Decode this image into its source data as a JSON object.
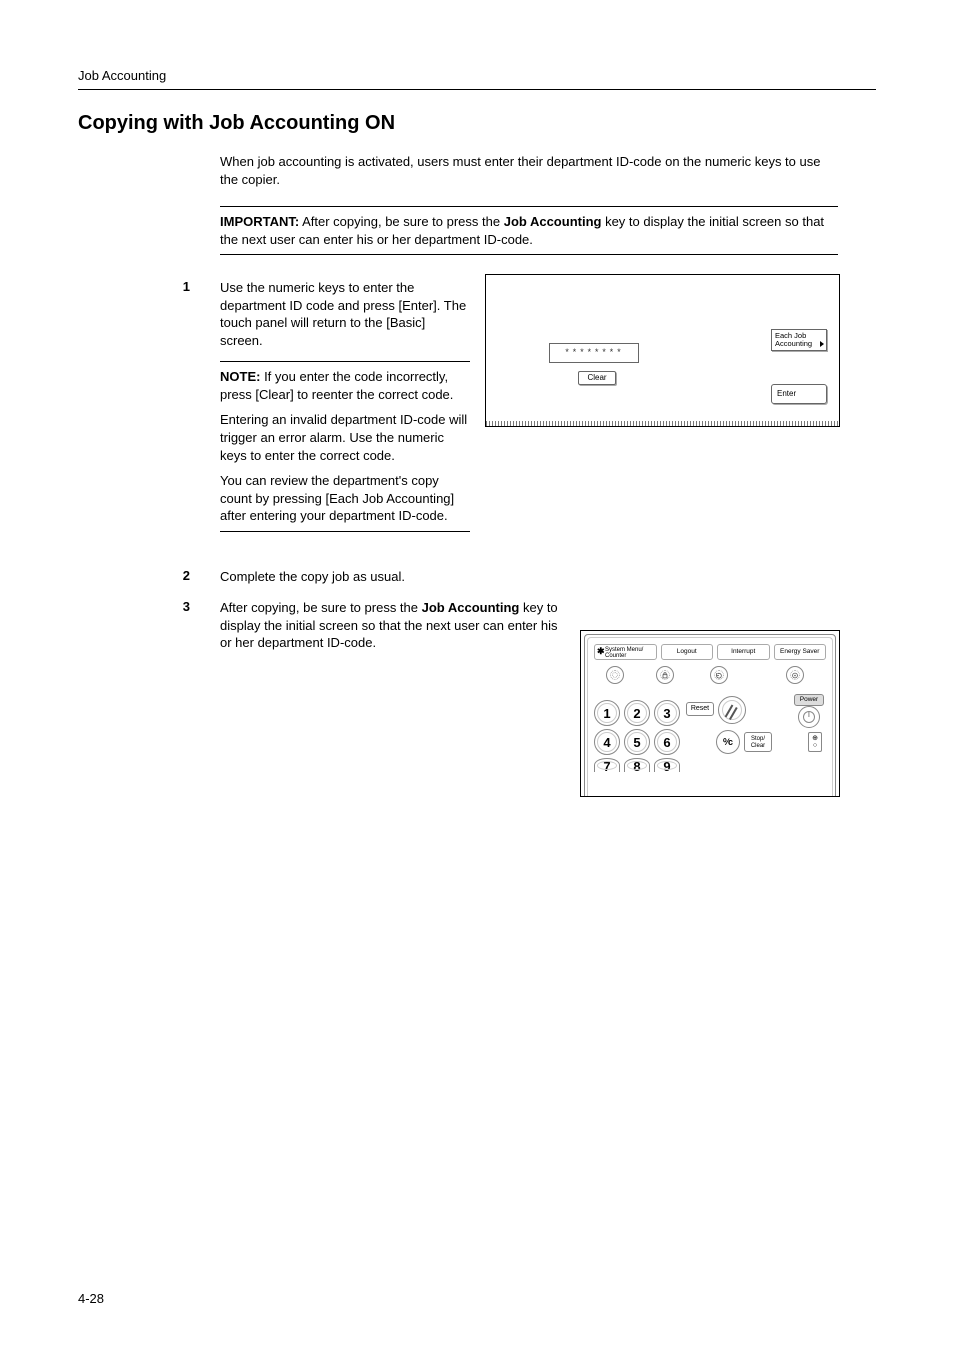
{
  "header": "Job Accounting",
  "heading": "Copying with Job Accounting ON",
  "intro": "When job accounting is activated, users must enter their department ID-code on the numeric keys to use the copier.",
  "important": {
    "label": "IMPORTANT:",
    "before": " After copying, be sure to press the ",
    "bold": "Job Accounting",
    "after": " key to display the initial screen so that the next user can enter his or her department ID-code."
  },
  "steps": {
    "s1": {
      "num": "1",
      "text": "Use the numeric keys to enter the department ID code and press [Enter]. The touch panel will return to the [Basic] screen.",
      "note": {
        "label": "NOTE:",
        "p1": " If you enter the code incorrectly, press [Clear] to reenter the correct code.",
        "p2": "Entering an invalid department ID-code will trigger an error alarm. Use the numeric keys to enter the correct code.",
        "p3": "You can review the department's copy count by pressing [Each Job Accounting] after entering your department ID-code."
      }
    },
    "s2": {
      "num": "2",
      "text": "Complete the copy job as usual."
    },
    "s3": {
      "num": "3",
      "before": "After copying, be sure to press the ",
      "bold": "Job Accounting",
      "after": " key to display the initial screen so that the next user can enter his or her department ID-code."
    }
  },
  "touchpanel": {
    "code": "********",
    "clear": "Clear",
    "each_job": "Each Job Accounting",
    "enter": "Enter"
  },
  "keypad": {
    "system": "System Menu/ Counter",
    "logout": "Logout",
    "interrupt": "Interrupt",
    "energy": "Energy Saver",
    "reset": "Reset",
    "stopclear": "Stop/ Clear",
    "power": "Power",
    "pc": "%/c",
    "n1": "1",
    "n2": "2",
    "n3": "3",
    "n4": "4",
    "n5": "5",
    "n6": "6",
    "n7": "7",
    "n8": "8",
    "n9": "9"
  },
  "page_num": "4-28"
}
